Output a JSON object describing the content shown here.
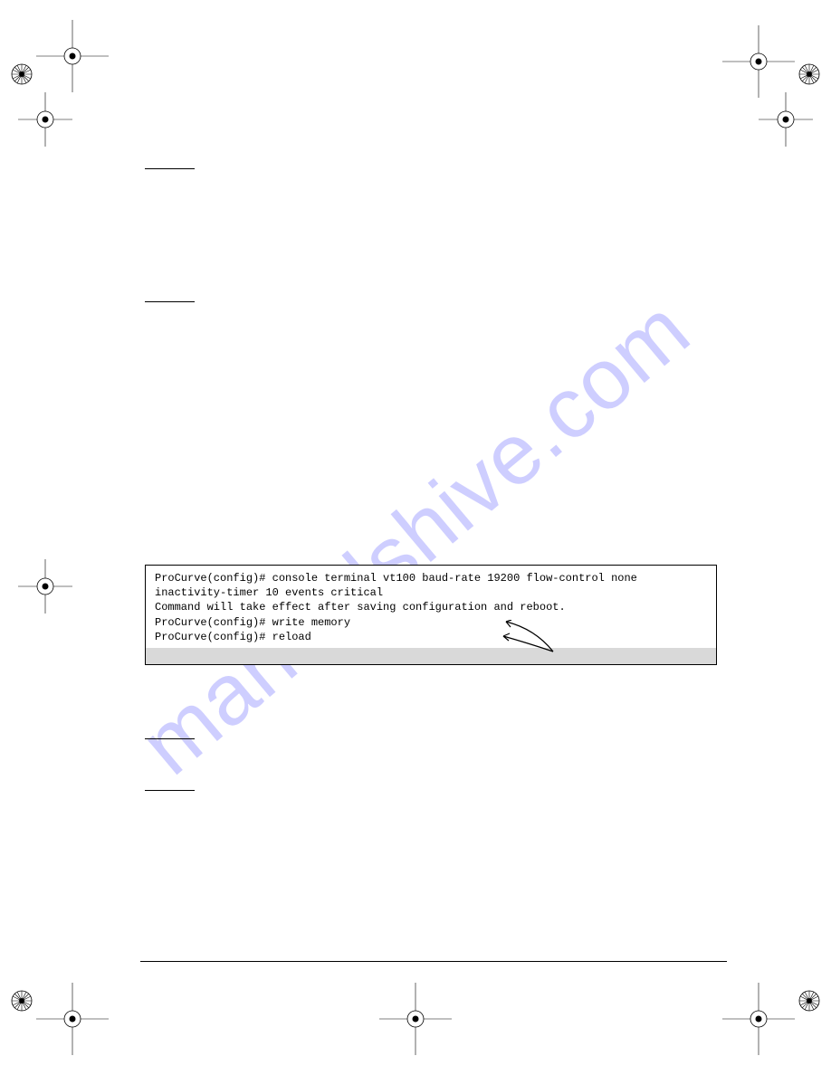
{
  "watermark": "manualshive.com",
  "terminal": {
    "line1": "ProCurve(config)# console terminal vt100 baud-rate 19200 flow-control none",
    "line2": "inactivity-timer 10 events critical",
    "line3": "Command will take effect after saving configuration and reboot.",
    "line4": "ProCurve(config)# write memory",
    "line5": "ProCurve(config)# reload"
  }
}
